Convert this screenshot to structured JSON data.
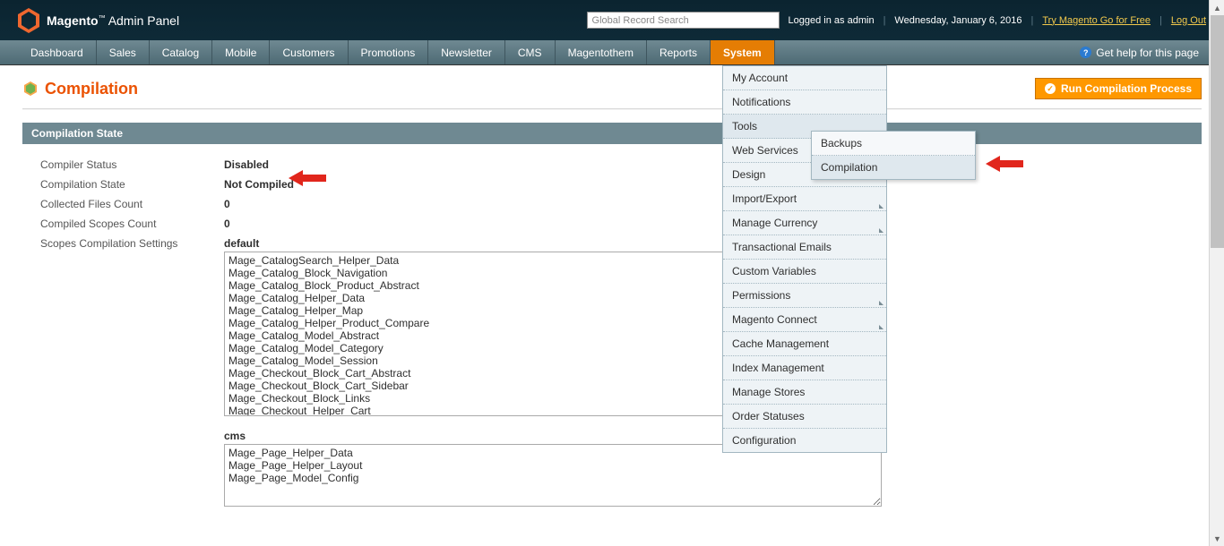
{
  "header": {
    "brand_prefix": "Magento",
    "brand_suffix": "Admin Panel",
    "search_placeholder": "Global Record Search",
    "logged_in": "Logged in as admin",
    "date": "Wednesday, January 6, 2016",
    "try_link": "Try Magento Go for Free",
    "logout": "Log Out"
  },
  "menu": {
    "items": [
      "Dashboard",
      "Sales",
      "Catalog",
      "Mobile",
      "Customers",
      "Promotions",
      "Newsletter",
      "CMS",
      "Magentothem",
      "Reports",
      "System"
    ],
    "help": "Get help for this page"
  },
  "dropdown": {
    "items": [
      {
        "label": "My Account",
        "sub": false
      },
      {
        "label": "Notifications",
        "sub": false
      },
      {
        "label": "Tools",
        "sub": true
      },
      {
        "label": "Web Services",
        "sub": true
      },
      {
        "label": "Design",
        "sub": false
      },
      {
        "label": "Import/Export",
        "sub": true
      },
      {
        "label": "Manage Currency",
        "sub": true
      },
      {
        "label": "Transactional Emails",
        "sub": false
      },
      {
        "label": "Custom Variables",
        "sub": false
      },
      {
        "label": "Permissions",
        "sub": true
      },
      {
        "label": "Magento Connect",
        "sub": true
      },
      {
        "label": "Cache Management",
        "sub": false
      },
      {
        "label": "Index Management",
        "sub": false
      },
      {
        "label": "Manage Stores",
        "sub": false
      },
      {
        "label": "Order Statuses",
        "sub": false
      },
      {
        "label": "Configuration",
        "sub": false
      }
    ]
  },
  "submenu": {
    "items": [
      "Backups",
      "Compilation"
    ]
  },
  "page": {
    "title": "Compilation",
    "run_btn": "Run Compilation Process",
    "panel_title": "Compilation State",
    "rows": {
      "compiler_status_label": "Compiler Status",
      "compiler_status_value": "Disabled",
      "compilation_state_label": "Compilation State",
      "compilation_state_value": "Not Compiled",
      "collected_files_label": "Collected Files Count",
      "collected_files_value": "0",
      "compiled_scopes_label": "Compiled Scopes Count",
      "compiled_scopes_value": "0",
      "scopes_settings_label": "Scopes Compilation Settings",
      "default_label": "default",
      "default_text": "Mage_CatalogSearch_Helper_Data\nMage_Catalog_Block_Navigation\nMage_Catalog_Block_Product_Abstract\nMage_Catalog_Helper_Data\nMage_Catalog_Helper_Map\nMage_Catalog_Helper_Product_Compare\nMage_Catalog_Model_Abstract\nMage_Catalog_Model_Category\nMage_Catalog_Model_Session\nMage_Checkout_Block_Cart_Abstract\nMage_Checkout_Block_Cart_Sidebar\nMage_Checkout_Block_Links\nMage_Checkout_Helper_Cart",
      "cms_label": "cms",
      "cms_text": "Mage_Page_Helper_Data\nMage_Page_Helper_Layout\nMage_Page_Model_Config"
    }
  }
}
